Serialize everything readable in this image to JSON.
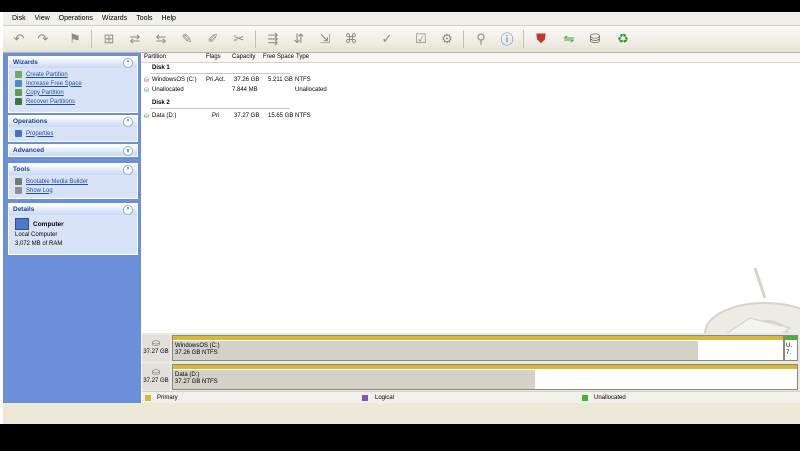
{
  "menu": [
    "Disk",
    "View",
    "Operations",
    "Wizards",
    "Tools",
    "Help"
  ],
  "toolbar_icons": [
    "undo-icon",
    "redo-icon",
    "apply-icon",
    "create-partition-icon",
    "move-resize-icon",
    "delete-icon",
    "format-icon",
    "hide-icon",
    "copy-icon",
    "merge-icon",
    "split-icon",
    "label-icon",
    "defrag-icon",
    "check-icon",
    "properties-icon",
    "help-icon",
    "info-icon",
    "create-bootable-icon",
    "migrate-icon",
    "backup-icon",
    "recovery-icon"
  ],
  "sidebar": {
    "wizards": {
      "title": "Wizards",
      "items": [
        "Create Partition",
        "Increase Free Space",
        "Copy Partition",
        "Recover Partitions"
      ]
    },
    "operations": {
      "title": "Operations",
      "items": [
        "Properties"
      ]
    },
    "advanced": {
      "title": "Advanced"
    },
    "tools": {
      "title": "Tools",
      "items": [
        "Bootable Media Builder",
        "Show Log"
      ]
    },
    "details": {
      "title": "Details",
      "computer": "Computer",
      "desc": "Local Computer",
      "ram": "3,072 MB of RAM"
    }
  },
  "columns": [
    "Partition",
    "Flags",
    "Capacity",
    "Free Space",
    "Type"
  ],
  "disk1": {
    "label": "Disk 1",
    "rows": [
      {
        "name": "WindowsOS (C:)",
        "flags": "Pri,Act.",
        "capacity": "37.26 GB",
        "free": "5.211 GB",
        "type": "NTFS"
      },
      {
        "name": "Unallocated",
        "flags": "",
        "capacity": "7.844 MB",
        "free": "",
        "type": "Unallocated"
      }
    ]
  },
  "disk2": {
    "label": "Disk 2",
    "rows": [
      {
        "name": "Data (D:)",
        "flags": "Pri",
        "capacity": "37.27 GB",
        "free": "15.65 GB",
        "type": "NTFS"
      }
    ]
  },
  "map": {
    "disk1": {
      "size": "37.27 GB",
      "part_name": "WindowsOS (C:)",
      "part_info": "37.26 GB  NTFS",
      "unalloc1": "U.",
      "unalloc2": "7."
    },
    "disk2": {
      "size": "37.27 GB",
      "part_name": "Data (D:)",
      "part_info": "37.27 GB  NTFS"
    }
  },
  "legend": [
    "Primary",
    "Logical",
    "Unallocated"
  ],
  "colors": {
    "primary": "#d8b83b",
    "logical": "#7a5bb8",
    "unallocated": "#4caf3c",
    "sidebar": "#6c8fd9"
  }
}
